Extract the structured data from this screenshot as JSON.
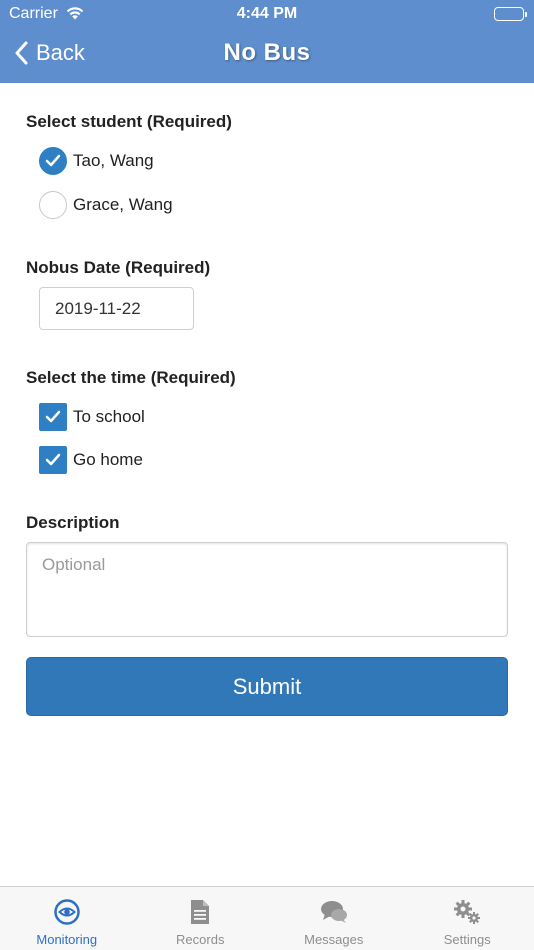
{
  "status_bar": {
    "carrier": "Carrier",
    "time": "4:44 PM"
  },
  "navbar": {
    "back_label": "Back",
    "title": "No Bus"
  },
  "student_section": {
    "label": "Select student (Required)",
    "options": [
      {
        "label": "Tao, Wang",
        "checked": true
      },
      {
        "label": "Grace, Wang",
        "checked": false
      }
    ]
  },
  "date_section": {
    "label": "Nobus Date (Required)",
    "value": "2019-11-22"
  },
  "time_section": {
    "label": "Select the time (Required)",
    "options": [
      {
        "label": "To school",
        "checked": true
      },
      {
        "label": "Go home",
        "checked": true
      }
    ]
  },
  "description_section": {
    "label": "Description",
    "placeholder": "Optional",
    "value": ""
  },
  "submit_label": "Submit",
  "tabbar": {
    "tabs": [
      {
        "label": "Monitoring",
        "icon": "monitoring-icon",
        "active": true
      },
      {
        "label": "Records",
        "icon": "document-icon",
        "active": false
      },
      {
        "label": "Messages",
        "icon": "chat-bubbles-icon",
        "active": false
      },
      {
        "label": "Settings",
        "icon": "gears-icon",
        "active": false
      }
    ]
  },
  "colors": {
    "header": "#5e8ecd",
    "accent": "#2f7fc5",
    "button": "#3178b8",
    "tab_active": "#2f6fc4",
    "tab_inactive": "#8e8e8e"
  }
}
